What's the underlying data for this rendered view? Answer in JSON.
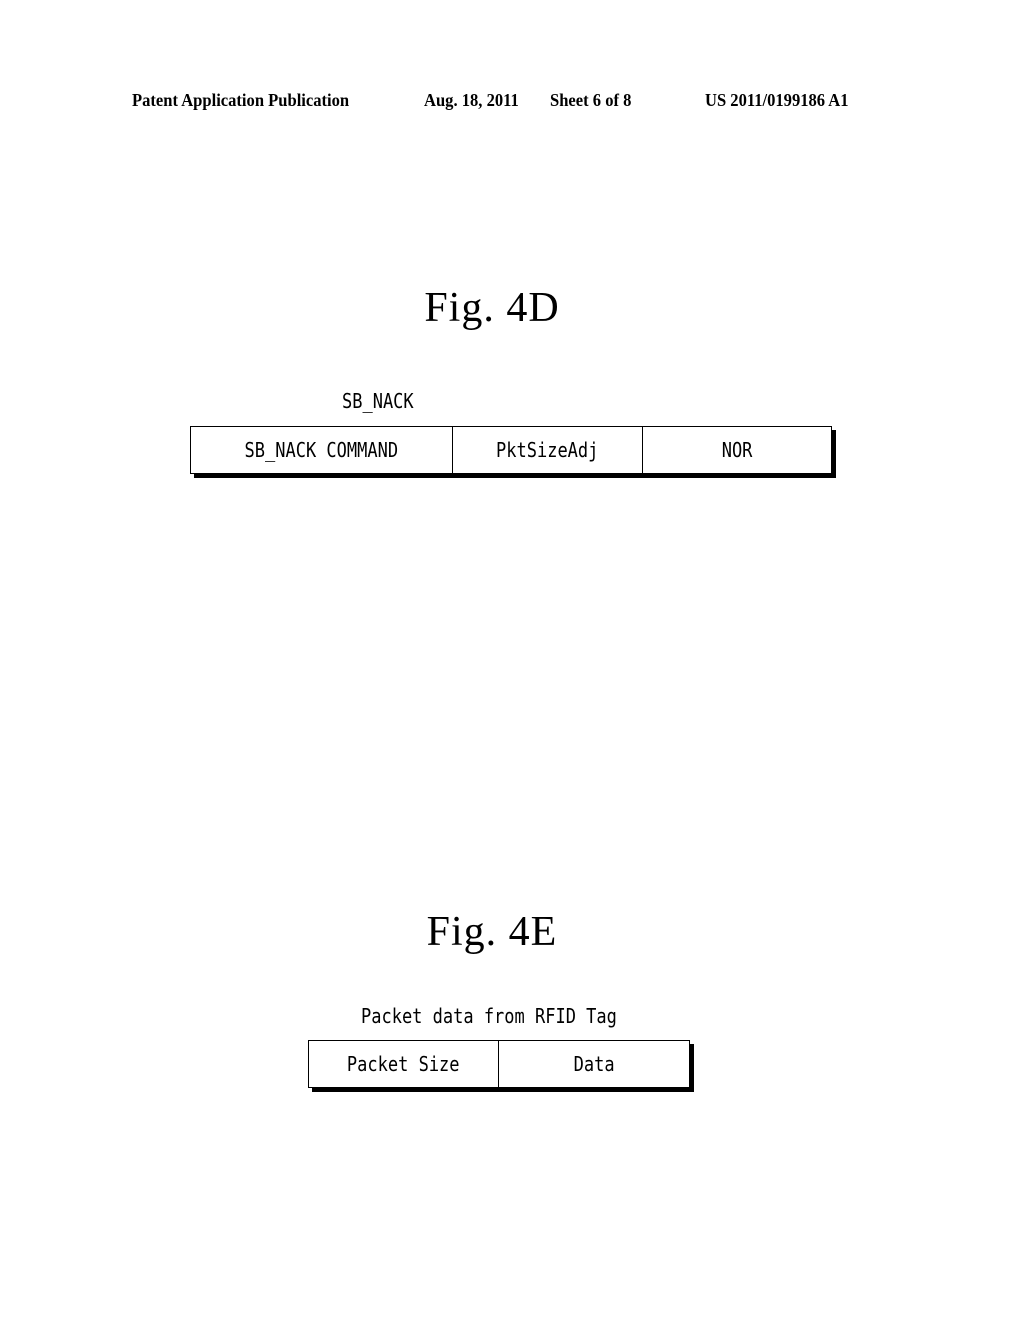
{
  "header": {
    "publication": "Patent Application Publication",
    "date": "Aug. 18, 2011",
    "sheet": "Sheet 6 of 8",
    "number": "US 2011/0199186 A1"
  },
  "figures": [
    {
      "title": "Fig. 4D",
      "frame_label": "SB_NACK",
      "fields": [
        "SB_NACK COMMAND",
        "PktSizeAdj",
        "NOR"
      ]
    },
    {
      "title": "Fig. 4E",
      "frame_label": "Packet data from RFID Tag",
      "fields": [
        "Packet Size",
        "Data"
      ]
    }
  ]
}
